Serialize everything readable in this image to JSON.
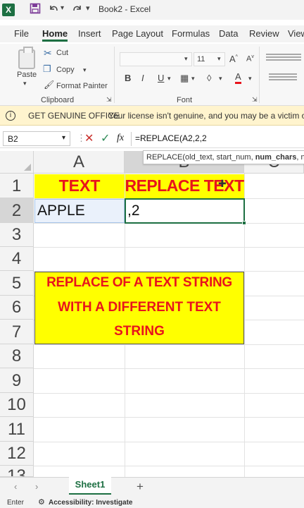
{
  "titlebar": {
    "app_icon": "X",
    "title": "Book2  -  Excel",
    "icons": [
      "save-icon",
      "undo-icon",
      "redo-icon",
      "customize-icon"
    ]
  },
  "menu": {
    "tabs": [
      "File",
      "Home",
      "Insert",
      "Page Layout",
      "Formulas",
      "Data",
      "Review",
      "View"
    ],
    "active": "Home"
  },
  "ribbon": {
    "paste_label": "Paste",
    "cut_label": "Cut",
    "copy_label": "Copy",
    "format_painter_label": "Format Painter",
    "clipboard_group": "Clipboard",
    "font_group": "Font",
    "font_size": "11",
    "bold": "B",
    "italic": "I",
    "underline": "U"
  },
  "notification": {
    "title": "GET GENUINE OFFICE",
    "message": "Your license isn't genuine, and you may be a victim of softw"
  },
  "formula_bar": {
    "name_box": "B2",
    "fx": "fx",
    "formula": "=REPLACE(A2,2,2",
    "tooltip_prefix": "REPLACE(old_text, start_num, ",
    "tooltip_bold": "num_chars",
    "tooltip_suffix": ", new_"
  },
  "grid": {
    "columns": [
      "A",
      "B",
      "C"
    ],
    "rows": [
      "1",
      "2",
      "3",
      "4",
      "5",
      "6",
      "7",
      "8",
      "9",
      "10",
      "11",
      "12",
      "13"
    ],
    "a1": "TEXT",
    "b1": "REPLACE TEXT",
    "a2": "APPLE",
    "b2": ",2",
    "merged_line1": "REPLACE OF A TEXT STRING",
    "merged_line2": "WITH A DIFFERENT TEXT",
    "merged_line3": "STRING",
    "highlight_color": "#ffff00",
    "text_color": "#e8141c"
  },
  "sheet": {
    "tab": "Sheet1",
    "add": "+"
  },
  "status": {
    "mode": "Enter",
    "accessibility": "Accessibility: Investigate"
  }
}
